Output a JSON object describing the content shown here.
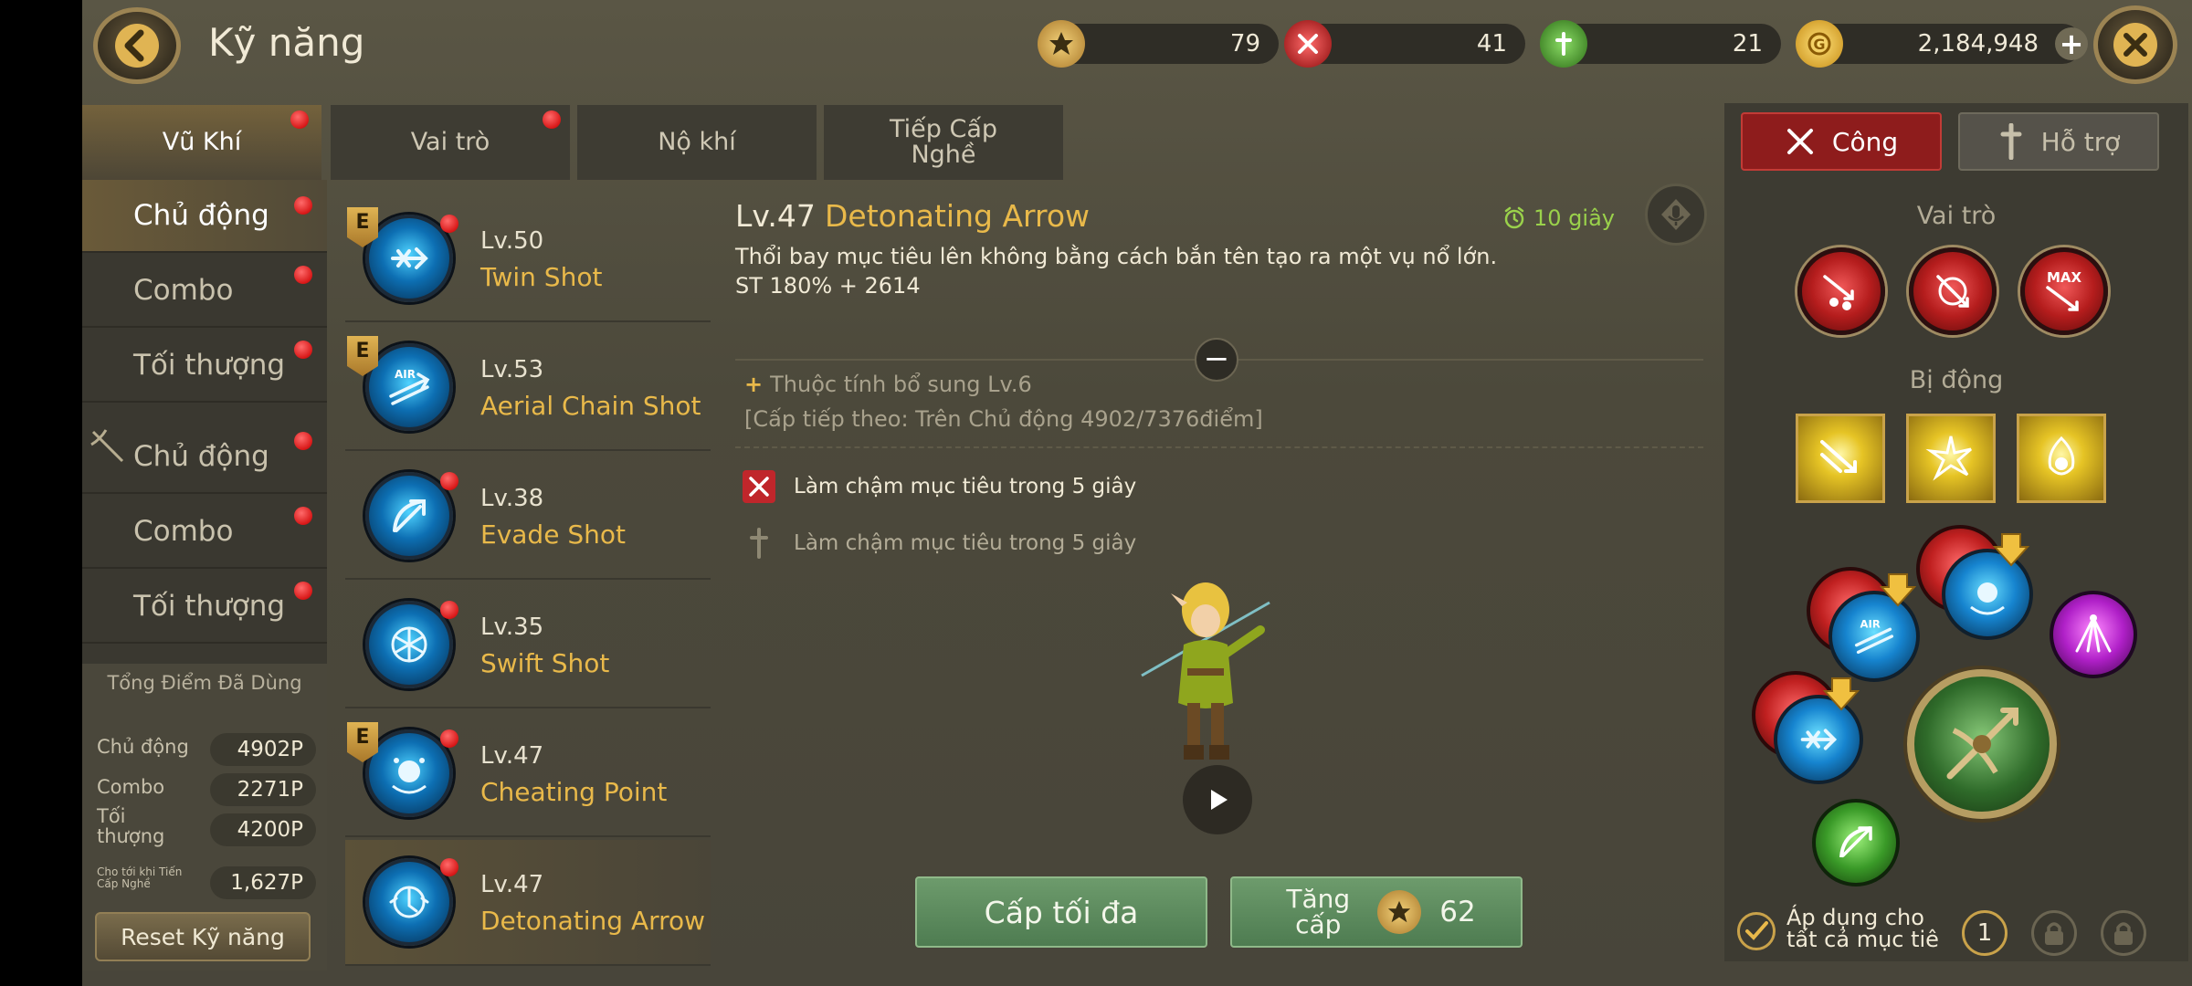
{
  "header": {
    "title": "Kỹ năng",
    "currencies": [
      {
        "icon": "star-badge-icon",
        "value": "79"
      },
      {
        "icon": "red-cross-badge-icon",
        "value": "41"
      },
      {
        "icon": "green-cross-badge-icon",
        "value": "21"
      },
      {
        "icon": "gold-coin-icon",
        "value": "2,184,948"
      }
    ]
  },
  "tabs": [
    {
      "label": "Vũ Khí",
      "active": true,
      "badge": true
    },
    {
      "label": "Vai trò",
      "active": false,
      "badge": true
    },
    {
      "label": "Nộ khí",
      "active": false,
      "badge": false
    },
    {
      "label": "Tiếp Cấp Nghề",
      "active": false,
      "badge": false
    }
  ],
  "categories": [
    {
      "label": "Chủ động",
      "active": true,
      "badge": true
    },
    {
      "label": "Combo",
      "active": false,
      "badge": true
    },
    {
      "label": "Tối thượng",
      "active": false,
      "badge": true
    },
    {
      "label": "Chủ động",
      "active": false,
      "badge": true
    },
    {
      "label": "Combo",
      "active": false,
      "badge": true
    },
    {
      "label": "Tối thượng",
      "active": false,
      "badge": true
    }
  ],
  "points": {
    "title": "Tổng Điểm Đã Dùng",
    "rows": [
      {
        "label": "Chủ động",
        "value": "4902P"
      },
      {
        "label": "Combo",
        "value": "2271P"
      },
      {
        "label": "Tối thượng",
        "value": "4200P"
      },
      {
        "label": "Cho tới khi Tiến Cấp Nghề",
        "value": "1,627P"
      }
    ],
    "reset_label": "Reset Kỹ năng"
  },
  "skills": [
    {
      "level": "Lv.50",
      "name": "Twin Shot",
      "elite": true,
      "badge": true
    },
    {
      "level": "Lv.53",
      "name": "Aerial Chain Shot",
      "elite": true,
      "badge": false
    },
    {
      "level": "Lv.38",
      "name": "Evade Shot",
      "elite": false,
      "badge": true
    },
    {
      "level": "Lv.35",
      "name": "Swift Shot",
      "elite": false,
      "badge": true
    },
    {
      "level": "Lv.47",
      "name": "Cheating Point",
      "elite": true,
      "badge": true
    },
    {
      "level": "Lv.47",
      "name": "Detonating Arrow",
      "elite": false,
      "badge": true,
      "selected": true
    }
  ],
  "detail": {
    "level": "Lv.47",
    "name": "Detonating Arrow",
    "cooldown": "10 giây",
    "description": "Thổi bay mục tiêu lên không bằng cách bắn tên tạo ra một vụ nổ lớn.",
    "stat": "ST 180% + 2614",
    "extra_attr": "Thuộc tính bổ sung Lv.6",
    "next_level": "[Cấp tiếp theo: Trên Chủ động 4902/7376điểm]",
    "effects": [
      {
        "icon": "attack-swords-icon",
        "text": "Làm chậm mục tiêu trong 5 giây",
        "active": true
      },
      {
        "icon": "support-cross-icon",
        "text": "Làm chậm mục tiêu trong 5 giây",
        "active": false
      }
    ]
  },
  "actions": {
    "max_label": "Cấp tối đa",
    "upgrade_label": "Tăng cấp",
    "upgrade_cost": "62"
  },
  "right_panel": {
    "tab_attack": "Công",
    "tab_support": "Hỗ trợ",
    "role_title": "Vai trò",
    "passive_title": "Bị động",
    "max_tag": "MAX",
    "air_tag": "AIR",
    "apply_label": "Áp dụng cho tất cả mục tiê",
    "slot_number": "1"
  },
  "colors": {
    "accent_gold": "#e9b94a",
    "cooldown_green": "#9ad14b",
    "attack_red": "#c0262b",
    "button_green": "#5d8a5e"
  }
}
